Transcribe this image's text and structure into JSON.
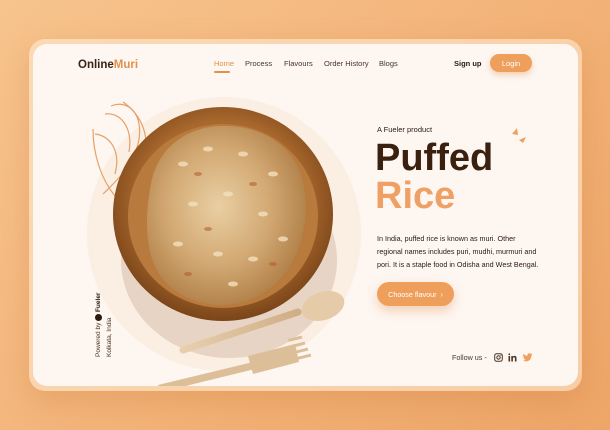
{
  "header": {
    "logo": {
      "main": "Online",
      "accent": "Muri"
    },
    "nav": [
      "Home",
      "Process",
      "Flavours",
      "Order History",
      "Blogs"
    ],
    "signup": "Sign up",
    "login": "Login"
  },
  "hero": {
    "tagline": "A Fueler product",
    "title_line1": "Puffed",
    "title_line2": "Rice",
    "description": "In India, puffed rice is known as muri. Other regional names includes puri, mudhi, murmuri and pori. It is a staple food in Odisha and West Bengal.",
    "cta": "Choose flavour",
    "cta_arrow": "›"
  },
  "footer": {
    "follow": "Follow us -",
    "social_icons": [
      "instagram-icon",
      "linkedin-icon",
      "twitter-icon"
    ],
    "powered_prefix": "Powered by",
    "powered_brand": "Fueler",
    "location": "Kolkata, India"
  },
  "colors": {
    "accent": "#ee9f5c",
    "dark": "#3a200e",
    "background": "#fdf6f1"
  }
}
